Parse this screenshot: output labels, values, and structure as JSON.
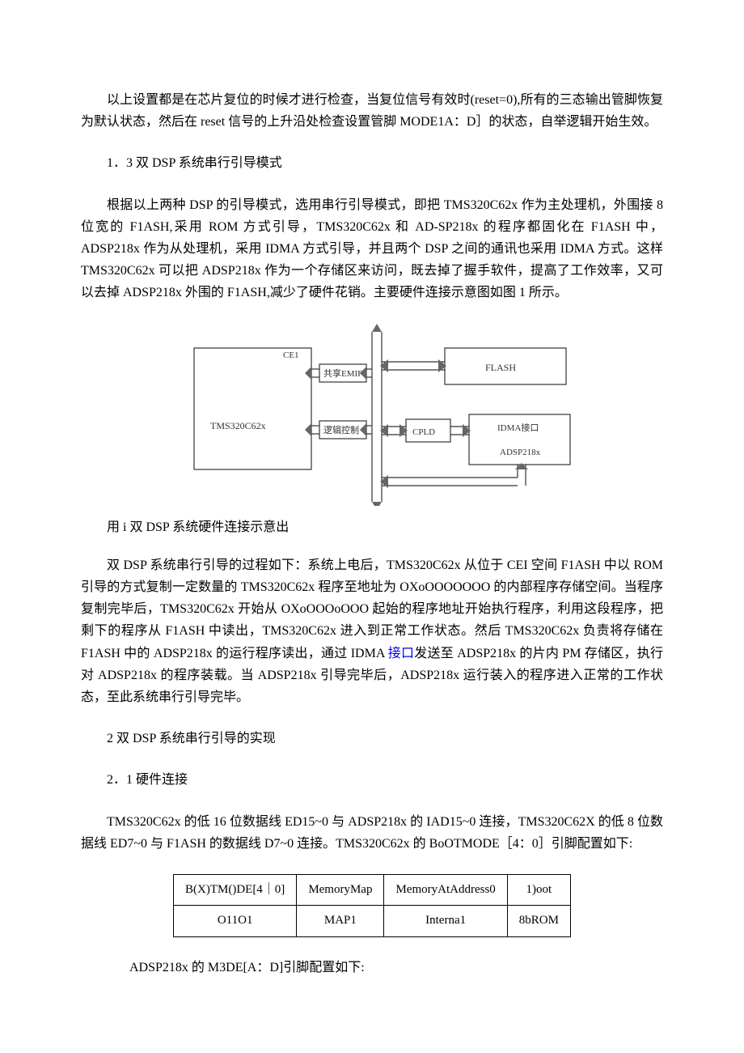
{
  "p1": "以上设置都是在芯片复位的时候才进行检查，当复位信号有效时(reset=0),所有的三态输出管脚恢复为默认状态，然后在 reset 信号的上升沿处检查设置管脚 MODE1A：D］的状态，自举逻辑开始生效。",
  "p2": "1．3 双 DSP 系统串行引导模式",
  "p3": "根据以上两种 DSP 的引导模式，选用串行引导模式，即把 TMS320C62x 作为主处理机，外围接 8 位宽的 F1ASH,采用 ROM 方式引导，TMS320C62x 和 AD-SP218x 的程序都固化在 F1ASH 中，ADSP218x 作为从处理机，采用 IDMA 方式引导，并且两个 DSP 之间的通讯也采用 IDMA 方式。这样 TMS320C62x 可以把 ADSP218x 作为一个存储区来访问，既去掉了握手软件，提高了工作效率，又可以去掉 ADSP218x 外围的 F1ASH,减少了硬件花销。主要硬件连接示意图如图 1 所示。",
  "diagram": {
    "tms": "TMS320C62x",
    "ce1": "CE1",
    "share_emif": "共享EMIF",
    "logic_ctrl": "逻辑控制",
    "cpld": "CPLD",
    "flash": "FLASH",
    "idma": "IDMA接口",
    "adsp": "ADSP218x"
  },
  "caption": "用 i 双 DSP 系统硬件连接示意出",
  "p4a": "双 DSP 系统串行引导的过程如下：系统上电后，TMS320C62x 从位于 CEI 空间 F1ASH 中以 ROM 引导的方式复制一定数量的 TMS320C62x 程序至地址为 OXoOOOOOOO 的内部程序存储空间。当程序复制完毕后，TMS320C62x 开始从 OXoOOOoOOO 起始的程序地址开始执行程序，利用这段程序，把剩下的程序从 F1ASH 中读出，TMS320C62x 进入到正常工作状态。然后 TMS320C62x 负责将存储在 F1ASH 中的 ADSP218x 的运行程序读出，通过 IDMA ",
  "link": "接口",
  "p4b": "发送至 ADSP218x 的片内 PM 存储区，执行对 ADSP218x 的程序装载。当 ADSP218x 引导完毕后，ADSP218x 运行装入的程序进入正常的工作状态，至此系统串行引导完毕。",
  "p5": "2 双 DSP 系统串行引导的实现",
  "p6": "2．1 硬件连接",
  "p7": "TMS320C62x 的低 16 位数据线 ED15~0 与 ADSP218x 的 IAD15~0 连接，TMS320C62X 的低 8 位数据线 ED7~0 与 F1ASH 的数据线 D7~0 连接。TMS320C62x 的 BoOTMODE［4：0］引脚配置如下:",
  "table": {
    "r1": {
      "c1": "B(X)TM()DE[4｜0]",
      "c2": "MemoryMap",
      "c3": "MemoryAtAddress0",
      "c4": "1)oot"
    },
    "r2": {
      "c1": "O11O1",
      "c2": "MAP1",
      "c3": "Interna1",
      "c4": "8bROM"
    }
  },
  "p8": "ADSP218x 的 M3DE[A：D]引脚配置如下:"
}
